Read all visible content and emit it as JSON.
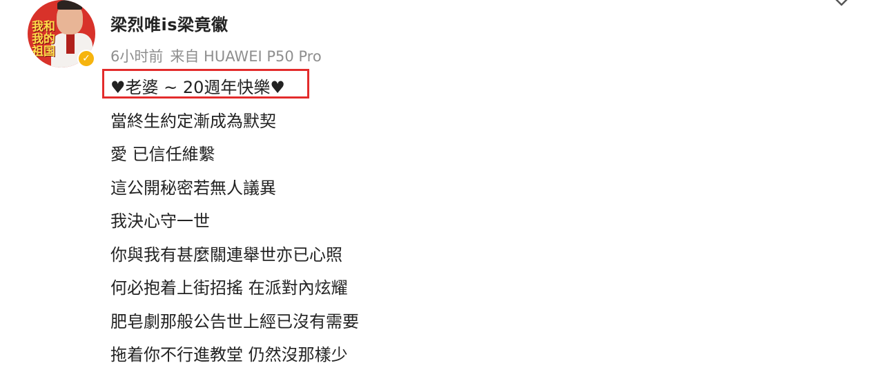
{
  "post": {
    "author": {
      "name": "梁烈唯is梁竟徽",
      "verified": true,
      "avatar_stamp": "我和我的祖国"
    },
    "meta": {
      "time": "6小时前",
      "source": "来自 HUAWEI P50 Pro"
    },
    "highlight_color": "#e32b2b",
    "badge_color": "#f6b40e",
    "lines": [
      "♥老婆 ~ 20週年快樂♥",
      "當終生約定漸成為默契",
      "愛 已信任維繫",
      "這公開秘密若無人議異",
      "我決心守一世",
      "你與我有甚麼關連舉世亦已心照",
      "何必抱着上街招搖 在派對內炫耀",
      "肥皂劇那般公告世上經已沒有需要",
      "拖着你不行進教堂 仍然沒那樣少"
    ]
  },
  "icons": {
    "more": "chevron-down-icon",
    "verified": "verified-badge-icon"
  }
}
